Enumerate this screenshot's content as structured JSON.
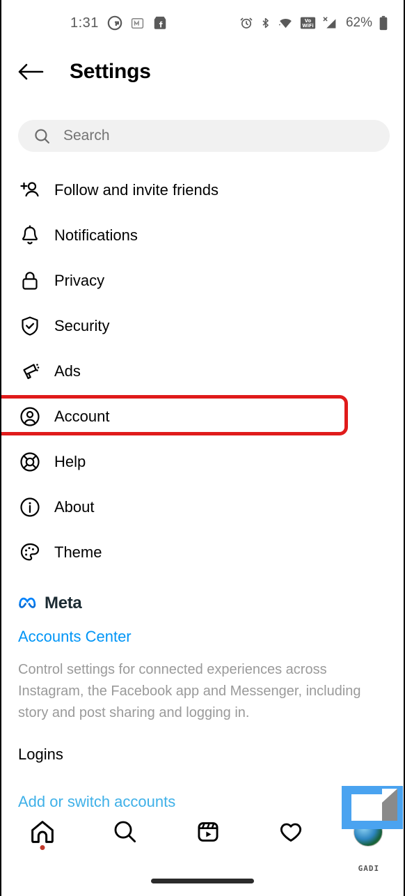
{
  "status_bar": {
    "time": "1:31",
    "left_icons": [
      "google-icon",
      "m-icon",
      "facebook-marketplace-icon"
    ],
    "right_icons": [
      "alarm-icon",
      "bluetooth-icon",
      "wifi-icon",
      "volte-wifi-icon",
      "signal-no-sim-icon"
    ],
    "battery_percent": "62%"
  },
  "header": {
    "back_label": "back-arrow",
    "title": "Settings"
  },
  "search": {
    "placeholder": "Search",
    "value": ""
  },
  "menu": {
    "items": [
      {
        "label": "Follow and invite friends",
        "icon": "add-person-icon",
        "highlighted": false
      },
      {
        "label": "Notifications",
        "icon": "bell-icon",
        "highlighted": false
      },
      {
        "label": "Privacy",
        "icon": "lock-icon",
        "highlighted": false
      },
      {
        "label": "Security",
        "icon": "shield-check-icon",
        "highlighted": false
      },
      {
        "label": "Ads",
        "icon": "megaphone-icon",
        "highlighted": false
      },
      {
        "label": "Account",
        "icon": "account-circle-icon",
        "highlighted": true
      },
      {
        "label": "Help",
        "icon": "life-ring-icon",
        "highlighted": false
      },
      {
        "label": "About",
        "icon": "info-circle-icon",
        "highlighted": false
      },
      {
        "label": "Theme",
        "icon": "palette-icon",
        "highlighted": false
      }
    ]
  },
  "meta_section": {
    "brand": "Meta",
    "accounts_center_link": "Accounts Center",
    "description": "Control settings for connected experiences across Instagram, the Facebook app and Messenger, including story and post sharing and logging in."
  },
  "logins_section": {
    "title": "Logins",
    "add_switch_link": "Add or switch accounts"
  },
  "bottom_nav": {
    "items": [
      {
        "name": "home-icon",
        "badge": true
      },
      {
        "name": "search-icon",
        "badge": false
      },
      {
        "name": "reels-icon",
        "badge": false
      },
      {
        "name": "heart-icon",
        "badge": false
      },
      {
        "name": "profile-avatar",
        "badge": false
      }
    ]
  },
  "watermark": {
    "text": "GADI"
  },
  "colors": {
    "highlight_red": "#e01b1b",
    "link_blue": "#0095f6",
    "meta_blue": "#0082fb",
    "search_bg": "#f1f1f1",
    "muted_text": "#9a9a9a"
  }
}
